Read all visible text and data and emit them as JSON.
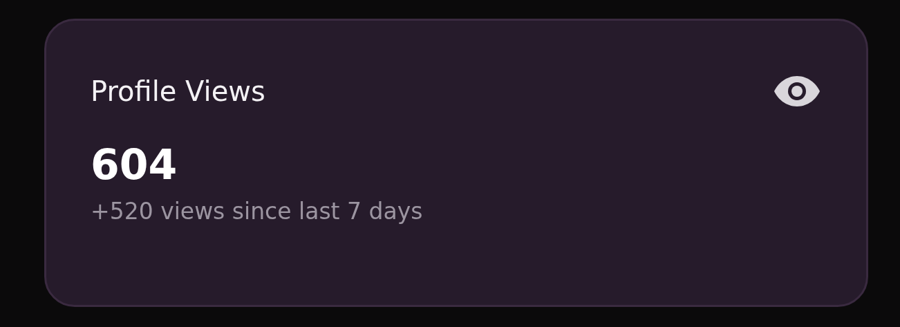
{
  "card": {
    "title": "Profile Views",
    "value": "604",
    "caption": "+520 views since last 7 days"
  }
}
